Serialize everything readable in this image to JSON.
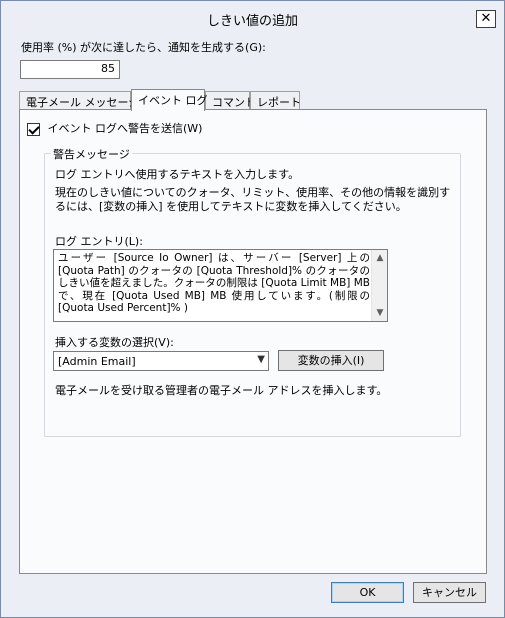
{
  "window": {
    "title": "しきい値の追加",
    "close_label": "✕"
  },
  "usage": {
    "label": "使用率 (%) が次に達したら、通知を生成する(G):",
    "value": "85"
  },
  "tabs": [
    {
      "label": "電子メール メッセージ",
      "active": false
    },
    {
      "label": "イベント ログ",
      "active": true
    },
    {
      "label": "コマンド",
      "active": false
    },
    {
      "label": "レポート",
      "active": false
    }
  ],
  "event_log": {
    "send_warning_label": "イベント ログへ警告を送信(W)",
    "send_warning_checked": true,
    "group_title": "警告メッセージ",
    "desc1": "ログ エントリへ使用するテキストを入力します。",
    "desc2": "現在のしきい値についてのクォータ、リミット、使用率、その他の情報を識別するには、[変数の挿入] を使用してテキストに変数を挿入してください。",
    "log_entry_label": "ログ エントリ(L):",
    "log_entry_text": "ユーザー [Source Io Owner] は、サーバー [Server] 上の [Quota Path] のクォータの [Quota Threshold]% のクォータのしきい値を超えました。クォータの制限は [Quota Limit MB] MB で、現在 [Quota Used MB] MB 使用しています。(制限の [Quota Used Percent]% )",
    "variable_label": "挿入する変数の選択(V):",
    "variable_selected": "[Admin Email]",
    "insert_button": "変数の挿入(I)",
    "variable_description": "電子メールを受け取る管理者の電子メール アドレスを挿入します。"
  },
  "buttons": {
    "ok": "OK",
    "cancel": "キャンセル"
  }
}
